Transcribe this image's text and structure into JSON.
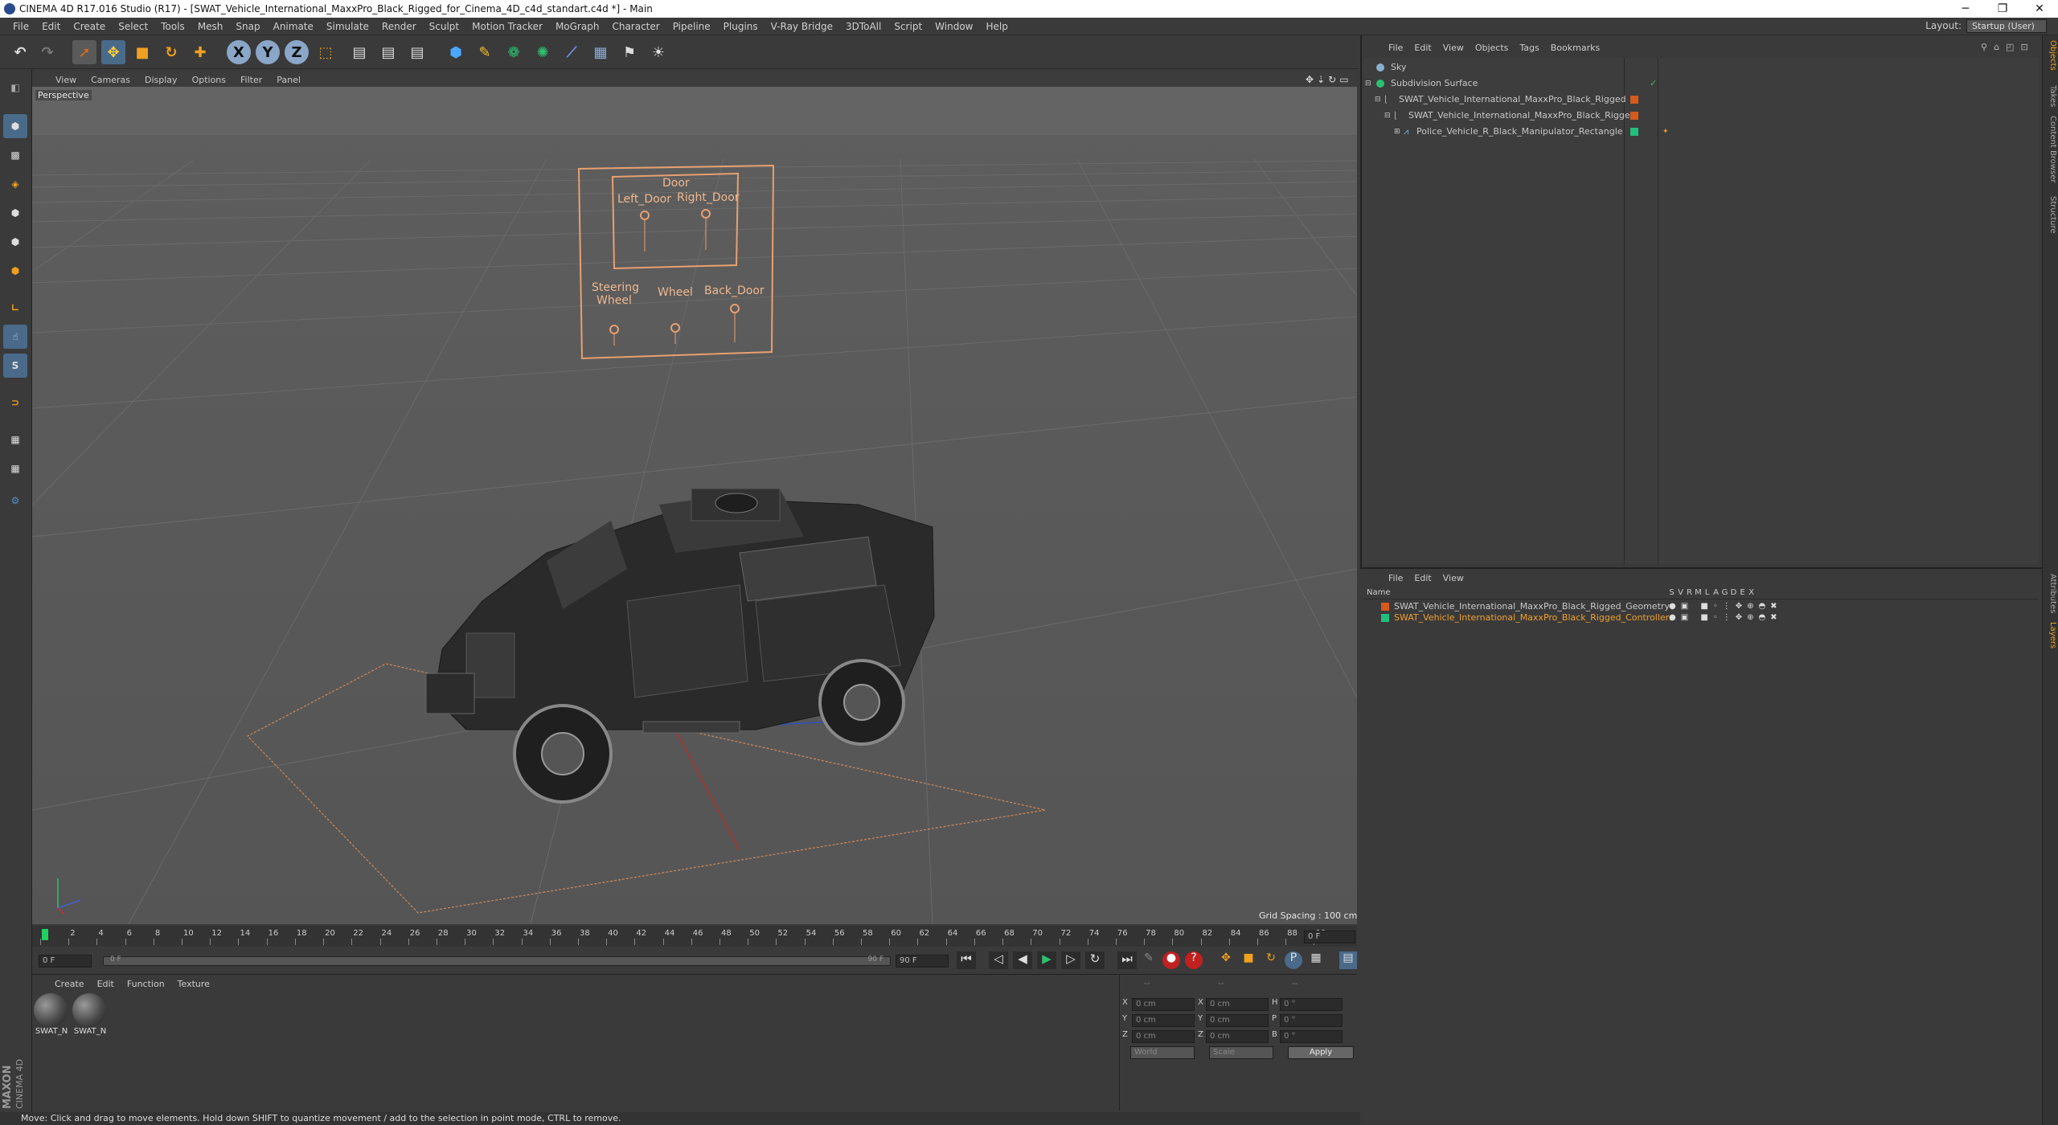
{
  "window": {
    "title": "CINEMA 4D R17.016 Studio (R17) - [SWAT_Vehicle_International_MaxxPro_Black_Rigged_for_Cinema_4D_c4d_standart.c4d *] - Main",
    "controls": [
      "─",
      "❐",
      "✕"
    ]
  },
  "menu": [
    "File",
    "Edit",
    "Create",
    "Select",
    "Tools",
    "Mesh",
    "Snap",
    "Animate",
    "Simulate",
    "Render",
    "Sculpt",
    "Motion Tracker",
    "MoGraph",
    "Character",
    "Pipeline",
    "Plugins",
    "V-Ray Bridge",
    "3DToAll",
    "Script",
    "Window",
    "Help"
  ],
  "layout": {
    "label": "Layout:",
    "value": "Startup (User)"
  },
  "toolbar_axes": [
    "X",
    "Y",
    "Z"
  ],
  "viewport": {
    "menu": [
      "View",
      "Cameras",
      "Display",
      "Options",
      "Filter",
      "Panel"
    ],
    "camera_label": "Perspective",
    "grid_spacing": "Grid Spacing : 100 cm",
    "hud": {
      "door_title": "Door",
      "left_door": "Left_Door",
      "right_door": "Right_Door",
      "steering": "Steering",
      "steering2": "Wheel",
      "wheel": "Wheel",
      "back_door": "Back_Door"
    }
  },
  "timeline": {
    "ticks": [
      "0",
      "2",
      "4",
      "6",
      "8",
      "10",
      "12",
      "14",
      "16",
      "18",
      "20",
      "22",
      "24",
      "26",
      "28",
      "30",
      "32",
      "34",
      "36",
      "38",
      "40",
      "42",
      "44",
      "46",
      "48",
      "50",
      "52",
      "54",
      "56",
      "58",
      "60",
      "62",
      "64",
      "66",
      "68",
      "70",
      "72",
      "74",
      "76",
      "78",
      "80",
      "82",
      "84",
      "86",
      "88",
      "90"
    ],
    "current_frame": "0 F",
    "start": "0 F",
    "range_start": "0 F",
    "range_end": "90 F",
    "end": "90 F"
  },
  "materials": {
    "menu": [
      "Create",
      "Edit",
      "Function",
      "Texture"
    ],
    "items": [
      {
        "label": "SWAT_N"
      },
      {
        "label": "SWAT_N"
      }
    ]
  },
  "coords": {
    "rows": [
      {
        "a": "X",
        "v1": "0 cm",
        "b": "X",
        "v2": "0 cm",
        "c": "H",
        "v3": "0 °"
      },
      {
        "a": "Y",
        "v1": "0 cm",
        "b": "Y",
        "v2": "0 cm",
        "c": "P",
        "v3": "0 °"
      },
      {
        "a": "Z",
        "v1": "0 cm",
        "b": "Z",
        "v2": "0 cm",
        "c": "B",
        "v3": "0 °"
      }
    ],
    "mode": "World",
    "scale": "Scale",
    "apply": "Apply",
    "hdr1": "--",
    "hdr2": "--",
    "hdr3": "--"
  },
  "objects": {
    "menu": [
      "File",
      "Edit",
      "View",
      "Objects",
      "Tags",
      "Bookmarks"
    ],
    "rows": [
      {
        "name": "Sky",
        "color": "#888888"
      },
      {
        "name": "Subdivision Surface",
        "color": "#888888"
      },
      {
        "name": "SWAT_Vehicle_International_MaxxPro_Black_Rigged",
        "color": "#d65a1e"
      },
      {
        "name": "SWAT_Vehicle_International_MaxxPro_Black_Rigged",
        "color": "#d65a1e"
      },
      {
        "name": "Police_Vehicle_R_Black_Manipulator_Rectangle",
        "color": "#22c07a"
      }
    ]
  },
  "layers": {
    "menu": [
      "File",
      "Edit",
      "View"
    ],
    "header": {
      "name": "Name",
      "flags": [
        "S",
        "V",
        "R",
        "M",
        "L",
        "A",
        "G",
        "D",
        "E",
        "X"
      ]
    },
    "rows": [
      {
        "name": "SWAT_Vehicle_International_MaxxPro_Black_Rigged_Geometry",
        "color": "#d65a1e",
        "text_color": "#c8c8c8"
      },
      {
        "name": "SWAT_Vehicle_International_MaxxPro_Black_Rigged_Controllers",
        "color": "#22c07a",
        "text_color": "#f0a030"
      }
    ]
  },
  "side_tabs": [
    "Objects",
    "Takes",
    "Content Browser",
    "Structure",
    "Attributes",
    "Layers"
  ],
  "status": "Move: Click and drag to move elements. Hold down SHIFT to quantize movement / add to the selection in point mode, CTRL to remove.",
  "brand": {
    "maxon": "MAXON",
    "c4d": "CINEMA 4D"
  }
}
